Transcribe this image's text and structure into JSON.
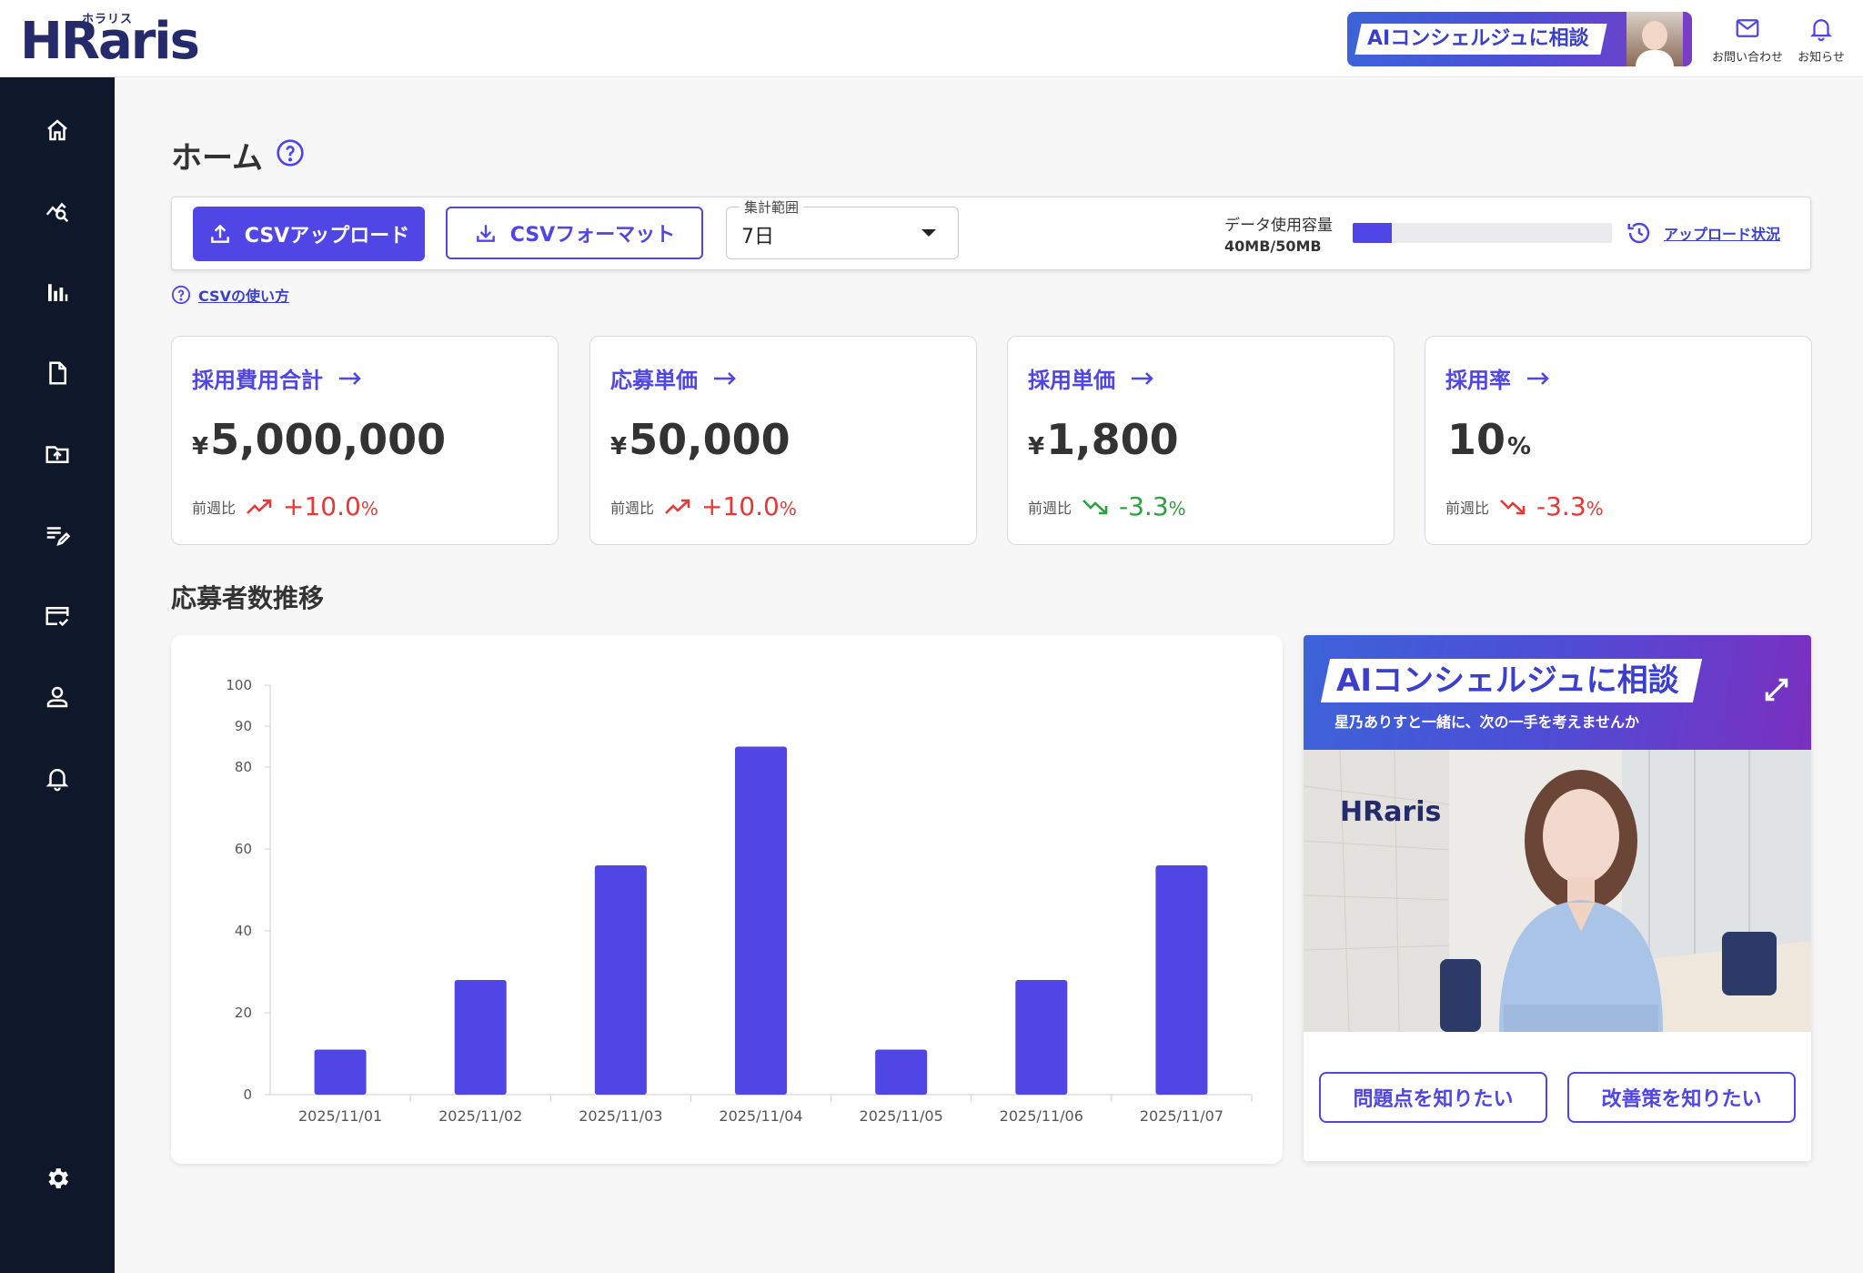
{
  "header": {
    "logo_text": "HRaris",
    "logo_kana": "ホラリス",
    "ai_banner_label": "AIコンシェルジュに相談",
    "contact_label": "お問い合わせ",
    "notice_label": "お知らせ"
  },
  "sidebar": {
    "items": [
      {
        "icon": "home-icon"
      },
      {
        "icon": "analytics-icon"
      },
      {
        "icon": "bar-chart-icon"
      },
      {
        "icon": "document-icon"
      },
      {
        "icon": "folder-upload-icon"
      },
      {
        "icon": "edit-list-icon"
      },
      {
        "icon": "card-check-icon"
      },
      {
        "icon": "user-icon"
      },
      {
        "icon": "bell-icon"
      }
    ],
    "settings_icon": "gear-icon"
  },
  "page": {
    "title": "ホーム"
  },
  "toolbar": {
    "upload_label": "CSVアップロード",
    "format_label": "CSVフォーマット",
    "range_label": "集計範囲",
    "range_value": "7日",
    "usage_label": "データ使用容量",
    "usage_value": "40MB/50MB",
    "usage_fraction": 0.15,
    "upload_status_label": "アップロード状況",
    "csv_help_label": "CSVの使い方"
  },
  "kpis": [
    {
      "title": "採用費用合計",
      "currency": "¥",
      "value": "5,000,000",
      "unit": "",
      "cmp_label": "前週比",
      "pct": "+10.0",
      "pct_unit": "%",
      "trend": "up"
    },
    {
      "title": "応募単価",
      "currency": "¥",
      "value": "50,000",
      "unit": "",
      "cmp_label": "前週比",
      "pct": "+10.0",
      "pct_unit": "%",
      "trend": "up"
    },
    {
      "title": "採用単価",
      "currency": "¥",
      "value": "1,800",
      "unit": "",
      "cmp_label": "前週比",
      "pct": "-3.3",
      "pct_unit": "%",
      "trend": "down-good"
    },
    {
      "title": "採用率",
      "currency": "",
      "value": "10",
      "unit": "%",
      "cmp_label": "前週比",
      "pct": "-3.3",
      "pct_unit": "%",
      "trend": "down-bad"
    }
  ],
  "chart_section_title": "応募者数推移",
  "chart_data": {
    "type": "bar",
    "categories": [
      "2025/11/01",
      "2025/11/02",
      "2025/11/03",
      "2025/11/04",
      "2025/11/05",
      "2025/11/06",
      "2025/11/07"
    ],
    "values": [
      11,
      28,
      56,
      85,
      11,
      28,
      56
    ],
    "yticks": [
      0,
      20,
      40,
      60,
      80,
      90,
      100
    ],
    "ylim": [
      0,
      100
    ],
    "colors": {
      "bar": "#4f46e5"
    },
    "grid": false
  },
  "ai_panel": {
    "title": "AIコンシェルジュに相談",
    "subtitle": "星乃ありすと一緒に、次の一手を考えませんか",
    "photo_logo": "HRaris",
    "btn_problem": "問題点を知りたい",
    "btn_improve": "改善策を知りたい"
  },
  "colors": {
    "accent": "#4f46e5",
    "sidebar": "#0f172a",
    "up": "#e53935",
    "down_good": "#2ea043"
  }
}
